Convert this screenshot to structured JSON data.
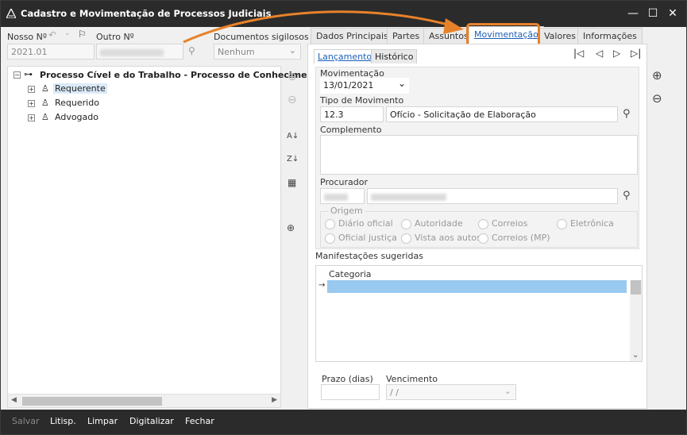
{
  "window": {
    "title": "Cadastro e Movimentação de Processos Judiciais",
    "minimize": "—",
    "maximize": "☐",
    "close": "✕"
  },
  "header": {
    "nosso_label": "Nosso Nº",
    "nosso_value": "2021.01",
    "outro_label": "Outro Nº",
    "docs_label": "Documentos sigilosos",
    "docs_value": "Nenhum"
  },
  "tree": {
    "root": "Processo Cível e do Trabalho - Processo de Conhecimento",
    "children": [
      "Requerente",
      "Requerido",
      "Advogado"
    ]
  },
  "tabs": [
    "Dados Principais",
    "Partes",
    "Assuntos",
    "Movimentação",
    "Valores",
    "Informações"
  ],
  "subtabs": [
    "Lançamento",
    "Histórico"
  ],
  "form": {
    "movimentacao_label": "Movimentação",
    "movimentacao_value": "13/01/2021",
    "tipo_label": "Tipo de Movimento",
    "tipo_code": "12.3",
    "tipo_desc": "Ofício - Solicitação de Elaboração",
    "complemento_label": "Complemento",
    "procurador_label": "Procurador",
    "origem_label": "Origem",
    "origem_options": [
      "Diário oficial",
      "Autoridade",
      "Correios",
      "Eletrônica",
      "Oficial justiça",
      "Vista aos autos",
      "Correios (MP)"
    ],
    "manifestacoes_label": "Manifestações sugeridas",
    "categoria_header": "Categoria",
    "prazo_label": "Prazo (dias)",
    "vencimento_label": "Vencimento",
    "vencimento_value": " / /"
  },
  "bottom": {
    "salvar": "Salvar",
    "litisp": "Litisp.",
    "limpar": "Limpar",
    "digitalizar": "Digitalizar",
    "fechar": "Fechar"
  },
  "colors": {
    "titlebar": "#2b2b2b",
    "highlight": "#e8822a",
    "selected_row": "#99c9ef",
    "accent": "#1c5fb8"
  }
}
